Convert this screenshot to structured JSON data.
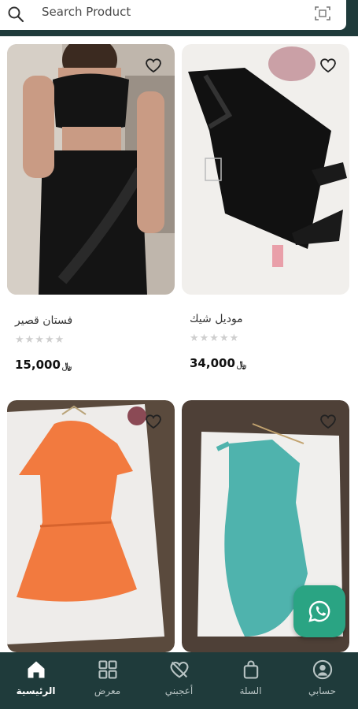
{
  "search": {
    "placeholder": "Search Product",
    "search_icon": "search-icon",
    "scan_icon": "scan-icon"
  },
  "colors": {
    "brand_dark": "#1f3b3b",
    "whatsapp": "#2aa483"
  },
  "products": [
    {
      "name": "فستان قصير",
      "rating": 0,
      "stars": "★★★★★",
      "price": "15,000",
      "currency": "﷼"
    },
    {
      "name": "موديل شيك",
      "rating": 0,
      "stars": "★★★★★",
      "price": "34,000",
      "currency": "﷼"
    },
    {
      "name": "",
      "stars": "",
      "price": "",
      "currency": ""
    },
    {
      "name": "",
      "stars": "",
      "price": "",
      "currency": ""
    }
  ],
  "nav": {
    "items": [
      {
        "label": "الرئيسية",
        "icon": "home-icon",
        "active": true
      },
      {
        "label": "معرض",
        "icon": "grid-icon"
      },
      {
        "label": "أعجبني",
        "icon": "heart-off-icon"
      },
      {
        "label": "السلة",
        "icon": "bag-icon"
      },
      {
        "label": "حسابي",
        "icon": "user-icon"
      }
    ]
  }
}
